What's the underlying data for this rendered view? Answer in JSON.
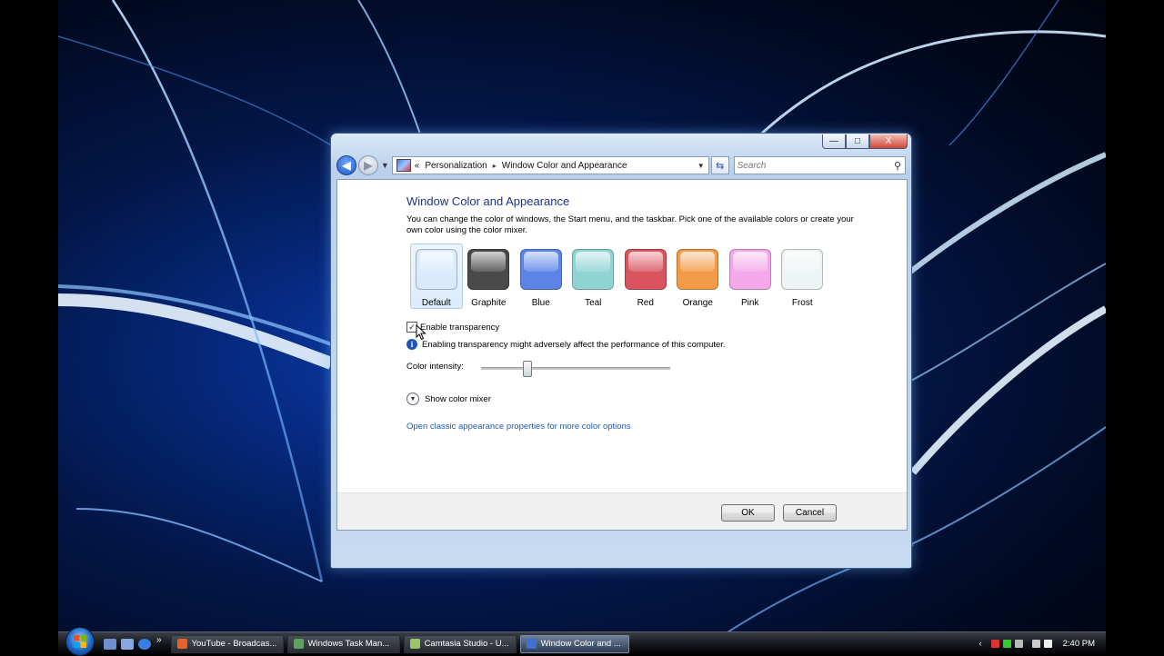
{
  "window": {
    "caption_buttons": {
      "minimize": "—",
      "maximize": "□",
      "close": "X"
    },
    "address": {
      "prefix": "«",
      "breadcrumb": [
        "Personalization",
        "Window Color and Appearance"
      ],
      "separator": "▸"
    },
    "search_placeholder": "Search",
    "content": {
      "title": "Window Color and Appearance",
      "description": "You can change the color of windows, the Start menu, and the taskbar. Pick one of the available colors or create your own color using the color mixer.",
      "swatches": [
        {
          "label": "Default",
          "color": "#d8eafb",
          "selected": true
        },
        {
          "label": "Graphite",
          "color": "#4a4a4a",
          "selected": false
        },
        {
          "label": "Blue",
          "color": "#5b84e6",
          "selected": false
        },
        {
          "label": "Teal",
          "color": "#8fd3d3",
          "selected": false
        },
        {
          "label": "Red",
          "color": "#d9545e",
          "selected": false
        },
        {
          "label": "Orange",
          "color": "#f39a46",
          "selected": false
        },
        {
          "label": "Pink",
          "color": "#f4a8ea",
          "selected": false
        },
        {
          "label": "Frost",
          "color": "#eef4f5",
          "selected": false
        }
      ],
      "enable_transparency": {
        "label": "Enable transparency",
        "checked": true
      },
      "warning": "Enabling transparency might adversely affect the performance of this computer.",
      "color_intensity": {
        "label": "Color intensity:",
        "value_percent": 24
      },
      "show_mixer": "Show color mixer",
      "classic_link": "Open classic appearance properties for more color options"
    },
    "buttons": {
      "ok": "OK",
      "cancel": "Cancel"
    }
  },
  "taskbar": {
    "overflow": "»",
    "tasks": [
      {
        "label": "YouTube - Broadcas...",
        "icon_color": "#e8622a",
        "active": false
      },
      {
        "label": "Windows Task Man...",
        "icon_color": "#5aa35a",
        "active": false
      },
      {
        "label": "Camtasia Studio - U...",
        "icon_color": "#9bc36a",
        "active": false
      },
      {
        "label": "Window Color and ...",
        "icon_color": "#3f6fd0",
        "active": true
      }
    ],
    "tray_arrow": "‹",
    "clock": "2:40 PM"
  }
}
